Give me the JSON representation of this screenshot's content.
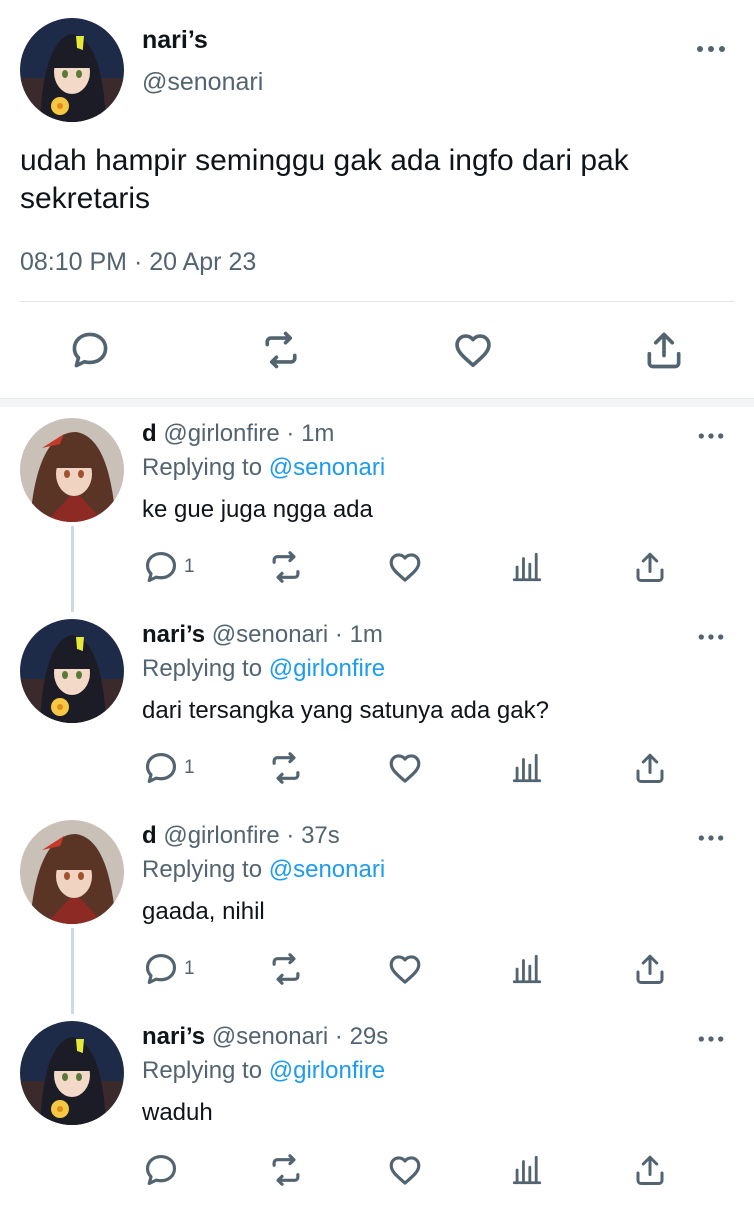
{
  "main_tweet": {
    "author_name": "nari’s",
    "author_handle": "@senonari",
    "text": "udah hampir seminggu gak ada ingfo dari pak sekretaris",
    "timestamp": "08:10 PM · 20 Apr 23",
    "actions": [
      "reply-icon",
      "retweet-icon",
      "like-icon",
      "share-icon"
    ]
  },
  "replies": [
    {
      "name": "d",
      "meta": " @girlonfire · 1m",
      "replying_prefix": "Replying to ",
      "replying_to": "@senonari",
      "text": "ke gue juga ngga ada",
      "reply_count": "1",
      "avatar_hair": "#5a3526"
    },
    {
      "name": "nari’s",
      "meta": " @senonari · 1m",
      "replying_prefix": "Replying to ",
      "replying_to": "@girlonfire",
      "text": "dari tersangka yang satunya ada gak?",
      "reply_count": "1",
      "avatar_hair": "#1c1c26"
    },
    {
      "name": "d",
      "meta": " @girlonfire · 37s",
      "replying_prefix": "Replying to ",
      "replying_to": "@senonari",
      "text": "gaada, nihil",
      "reply_count": "1",
      "avatar_hair": "#5a3526"
    },
    {
      "name": "nari’s",
      "meta": " @senonari · 29s",
      "replying_prefix": "Replying to ",
      "replying_to": "@girlonfire",
      "text": "waduh",
      "reply_count": "",
      "avatar_hair": "#1c1c26"
    }
  ],
  "colors": {
    "text": "#0f1419",
    "secondary": "#536471",
    "link": "#1d9bf0",
    "divider": "#e1e6ea"
  }
}
